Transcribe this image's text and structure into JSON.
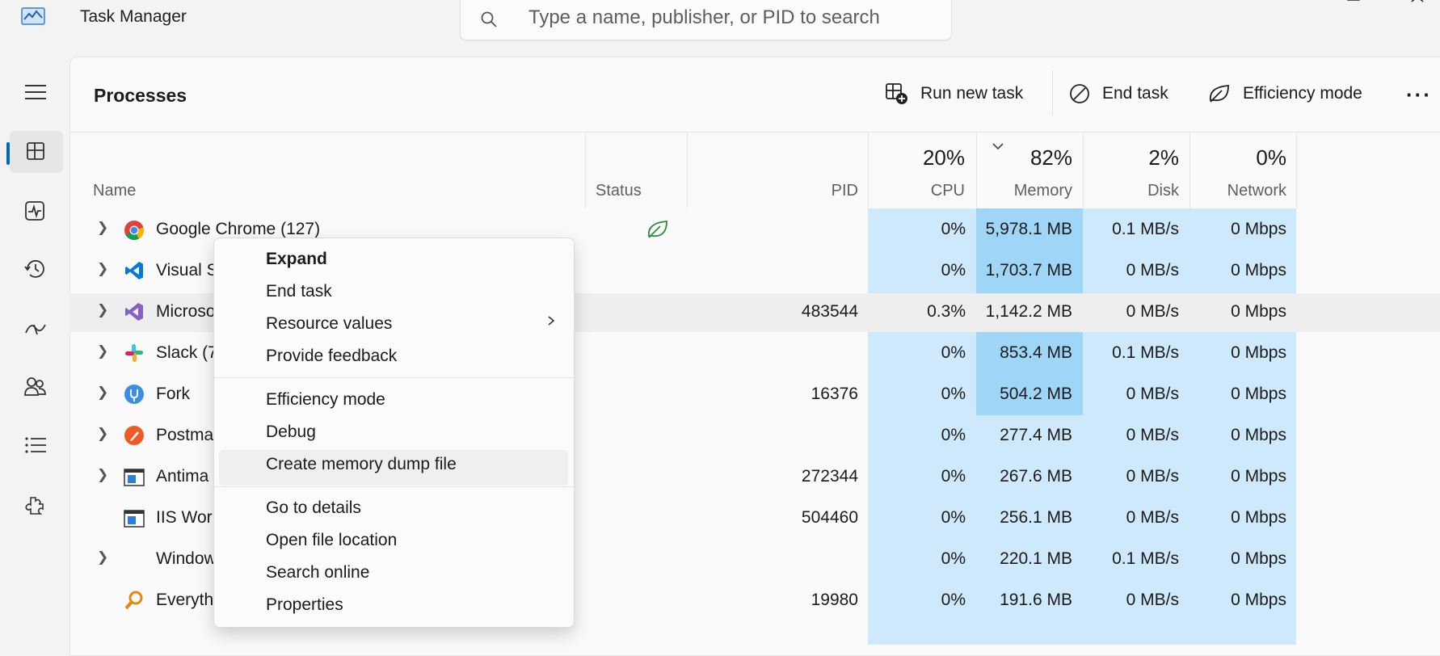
{
  "window": {
    "title": "Task Manager",
    "search_placeholder": "Type a name, publisher, or PID to search"
  },
  "sidebar": {
    "items": [
      {
        "icon": "hamburger-menu-icon"
      },
      {
        "icon": "processes-icon",
        "active": true
      },
      {
        "icon": "performance-icon"
      },
      {
        "icon": "app-history-icon"
      },
      {
        "icon": "startup-apps-icon"
      },
      {
        "icon": "users-icon"
      },
      {
        "icon": "details-icon"
      },
      {
        "icon": "services-icon"
      }
    ]
  },
  "header": {
    "title": "Processes",
    "run_new_task": "Run new task",
    "end_task": "End task",
    "efficiency_mode": "Efficiency mode",
    "more": "···"
  },
  "columns": {
    "name": "Name",
    "status": "Status",
    "pid": "PID",
    "cpu": {
      "pct": "20%",
      "label": "CPU"
    },
    "memory": {
      "pct": "82%",
      "label": "Memory"
    },
    "disk": {
      "pct": "2%",
      "label": "Disk"
    },
    "network": {
      "pct": "0%",
      "label": "Network"
    }
  },
  "rows": [
    {
      "name": "Google Chrome (127)",
      "pid": "",
      "cpu": "0%",
      "memory": "5,978.1 MB",
      "disk": "0.1 MB/s",
      "network": "0 Mbps",
      "status_icon": "efficiency-leaf-icon"
    },
    {
      "name": "Visual S",
      "pid": "",
      "cpu": "0%",
      "memory": "1,703.7 MB",
      "disk": "0 MB/s",
      "network": "0 Mbps"
    },
    {
      "name": "Microso",
      "pid": "483544",
      "cpu": "0.3%",
      "memory": "1,142.2 MB",
      "disk": "0 MB/s",
      "network": "0 Mbps"
    },
    {
      "name": "Slack (7",
      "pid": "",
      "cpu": "0%",
      "memory": "853.4 MB",
      "disk": "0.1 MB/s",
      "network": "0 Mbps"
    },
    {
      "name": "Fork",
      "pid": "16376",
      "cpu": "0%",
      "memory": "504.2 MB",
      "disk": "0 MB/s",
      "network": "0 Mbps"
    },
    {
      "name": "Postma",
      "pid": "",
      "cpu": "0%",
      "memory": "277.4 MB",
      "disk": "0 MB/s",
      "network": "0 Mbps"
    },
    {
      "name": "Antima",
      "pid": "272344",
      "cpu": "0%",
      "memory": "267.6 MB",
      "disk": "0 MB/s",
      "network": "0 Mbps"
    },
    {
      "name": "IIS Wor",
      "pid": "504460",
      "cpu": "0%",
      "memory": "256.1 MB",
      "disk": "0 MB/s",
      "network": "0 Mbps"
    },
    {
      "name": "Window",
      "pid": "",
      "cpu": "0%",
      "memory": "220.1 MB",
      "disk": "0.1 MB/s",
      "network": "0 Mbps"
    },
    {
      "name": "Everyth",
      "pid": "19980",
      "cpu": "0%",
      "memory": "191.6 MB",
      "disk": "0 MB/s",
      "network": "0 Mbps"
    }
  ],
  "context_menu": {
    "items": [
      "Expand",
      "End task",
      "Resource values",
      "Provide feedback",
      "Efficiency mode",
      "Debug",
      "Create memory dump file",
      "Go to details",
      "Open file location",
      "Search online",
      "Properties"
    ]
  },
  "colors": {
    "accent": "#0067c0",
    "heat_light": "#cde9fb",
    "heat_medium": "#9fd6f7",
    "efficiency_green": "#2e8b3d"
  }
}
